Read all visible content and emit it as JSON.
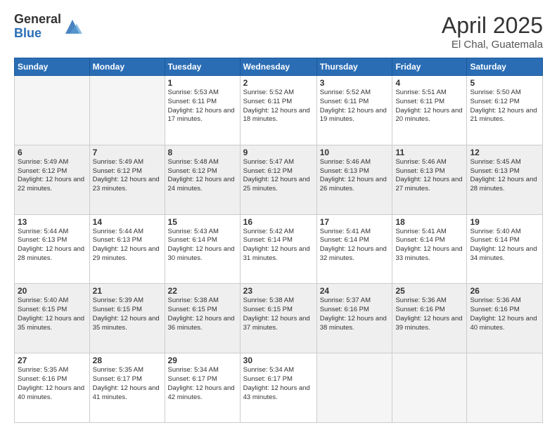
{
  "logo": {
    "general": "General",
    "blue": "Blue"
  },
  "title": "April 2025",
  "location": "El Chal, Guatemala",
  "days_of_week": [
    "Sunday",
    "Monday",
    "Tuesday",
    "Wednesday",
    "Thursday",
    "Friday",
    "Saturday"
  ],
  "weeks": [
    [
      {
        "day": "",
        "info": ""
      },
      {
        "day": "",
        "info": ""
      },
      {
        "day": "1",
        "info": "Sunrise: 5:53 AM\nSunset: 6:11 PM\nDaylight: 12 hours and 17 minutes."
      },
      {
        "day": "2",
        "info": "Sunrise: 5:52 AM\nSunset: 6:11 PM\nDaylight: 12 hours and 18 minutes."
      },
      {
        "day": "3",
        "info": "Sunrise: 5:52 AM\nSunset: 6:11 PM\nDaylight: 12 hours and 19 minutes."
      },
      {
        "day": "4",
        "info": "Sunrise: 5:51 AM\nSunset: 6:11 PM\nDaylight: 12 hours and 20 minutes."
      },
      {
        "day": "5",
        "info": "Sunrise: 5:50 AM\nSunset: 6:12 PM\nDaylight: 12 hours and 21 minutes."
      }
    ],
    [
      {
        "day": "6",
        "info": "Sunrise: 5:49 AM\nSunset: 6:12 PM\nDaylight: 12 hours and 22 minutes."
      },
      {
        "day": "7",
        "info": "Sunrise: 5:49 AM\nSunset: 6:12 PM\nDaylight: 12 hours and 23 minutes."
      },
      {
        "day": "8",
        "info": "Sunrise: 5:48 AM\nSunset: 6:12 PM\nDaylight: 12 hours and 24 minutes."
      },
      {
        "day": "9",
        "info": "Sunrise: 5:47 AM\nSunset: 6:12 PM\nDaylight: 12 hours and 25 minutes."
      },
      {
        "day": "10",
        "info": "Sunrise: 5:46 AM\nSunset: 6:13 PM\nDaylight: 12 hours and 26 minutes."
      },
      {
        "day": "11",
        "info": "Sunrise: 5:46 AM\nSunset: 6:13 PM\nDaylight: 12 hours and 27 minutes."
      },
      {
        "day": "12",
        "info": "Sunrise: 5:45 AM\nSunset: 6:13 PM\nDaylight: 12 hours and 28 minutes."
      }
    ],
    [
      {
        "day": "13",
        "info": "Sunrise: 5:44 AM\nSunset: 6:13 PM\nDaylight: 12 hours and 28 minutes."
      },
      {
        "day": "14",
        "info": "Sunrise: 5:44 AM\nSunset: 6:13 PM\nDaylight: 12 hours and 29 minutes."
      },
      {
        "day": "15",
        "info": "Sunrise: 5:43 AM\nSunset: 6:14 PM\nDaylight: 12 hours and 30 minutes."
      },
      {
        "day": "16",
        "info": "Sunrise: 5:42 AM\nSunset: 6:14 PM\nDaylight: 12 hours and 31 minutes."
      },
      {
        "day": "17",
        "info": "Sunrise: 5:41 AM\nSunset: 6:14 PM\nDaylight: 12 hours and 32 minutes."
      },
      {
        "day": "18",
        "info": "Sunrise: 5:41 AM\nSunset: 6:14 PM\nDaylight: 12 hours and 33 minutes."
      },
      {
        "day": "19",
        "info": "Sunrise: 5:40 AM\nSunset: 6:14 PM\nDaylight: 12 hours and 34 minutes."
      }
    ],
    [
      {
        "day": "20",
        "info": "Sunrise: 5:40 AM\nSunset: 6:15 PM\nDaylight: 12 hours and 35 minutes."
      },
      {
        "day": "21",
        "info": "Sunrise: 5:39 AM\nSunset: 6:15 PM\nDaylight: 12 hours and 35 minutes."
      },
      {
        "day": "22",
        "info": "Sunrise: 5:38 AM\nSunset: 6:15 PM\nDaylight: 12 hours and 36 minutes."
      },
      {
        "day": "23",
        "info": "Sunrise: 5:38 AM\nSunset: 6:15 PM\nDaylight: 12 hours and 37 minutes."
      },
      {
        "day": "24",
        "info": "Sunrise: 5:37 AM\nSunset: 6:16 PM\nDaylight: 12 hours and 38 minutes."
      },
      {
        "day": "25",
        "info": "Sunrise: 5:36 AM\nSunset: 6:16 PM\nDaylight: 12 hours and 39 minutes."
      },
      {
        "day": "26",
        "info": "Sunrise: 5:36 AM\nSunset: 6:16 PM\nDaylight: 12 hours and 40 minutes."
      }
    ],
    [
      {
        "day": "27",
        "info": "Sunrise: 5:35 AM\nSunset: 6:16 PM\nDaylight: 12 hours and 40 minutes."
      },
      {
        "day": "28",
        "info": "Sunrise: 5:35 AM\nSunset: 6:17 PM\nDaylight: 12 hours and 41 minutes."
      },
      {
        "day": "29",
        "info": "Sunrise: 5:34 AM\nSunset: 6:17 PM\nDaylight: 12 hours and 42 minutes."
      },
      {
        "day": "30",
        "info": "Sunrise: 5:34 AM\nSunset: 6:17 PM\nDaylight: 12 hours and 43 minutes."
      },
      {
        "day": "",
        "info": ""
      },
      {
        "day": "",
        "info": ""
      },
      {
        "day": "",
        "info": ""
      }
    ]
  ]
}
